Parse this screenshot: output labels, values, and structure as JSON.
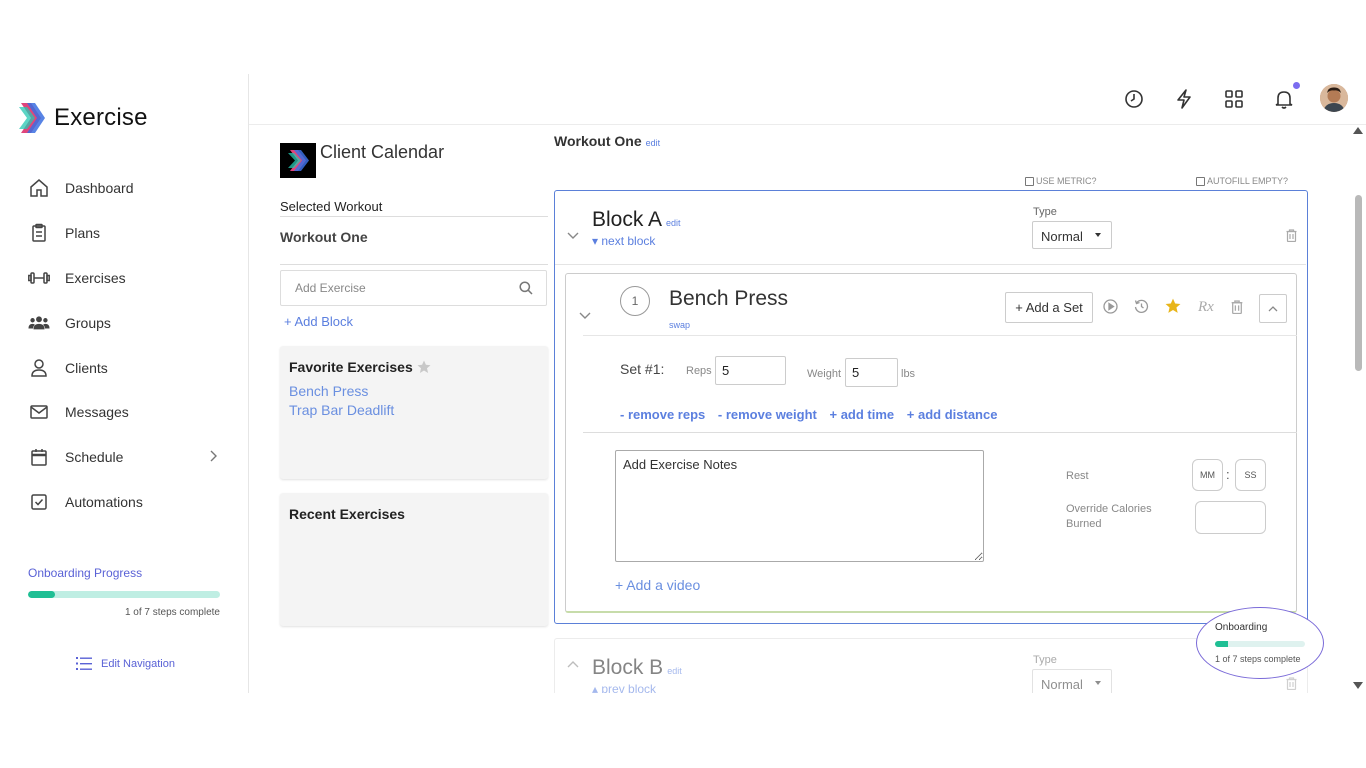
{
  "app": {
    "name": "Exercise"
  },
  "sidebar": {
    "items": [
      {
        "label": "Dashboard",
        "icon": "home-icon"
      },
      {
        "label": "Plans",
        "icon": "clipboard-icon"
      },
      {
        "label": "Exercises",
        "icon": "dumbbell-icon"
      },
      {
        "label": "Groups",
        "icon": "group-icon"
      },
      {
        "label": "Clients",
        "icon": "user-icon"
      },
      {
        "label": "Messages",
        "icon": "mail-icon"
      },
      {
        "label": "Schedule",
        "icon": "calendar-icon"
      },
      {
        "label": "Automations",
        "icon": "checkbox-icon"
      }
    ],
    "onboarding": {
      "title": "Onboarding Progress",
      "steps_text": "1 of 7 steps complete",
      "progress": 0.14
    },
    "edit_navigation": "Edit Navigation"
  },
  "topbar": {
    "icons": [
      "clock-icon",
      "lightning-icon",
      "grid-icon",
      "bell-icon",
      "avatar"
    ]
  },
  "colors": {
    "accent": "#5b80d8",
    "brand_purple": "#5a62d6",
    "progress_green": "#1fbf94",
    "star_gold": "#e8b51a"
  },
  "left_panel": {
    "title": "Client Calendar",
    "selected_label": "Selected Workout",
    "selected_workout": "Workout One",
    "search_placeholder": "Add Exercise",
    "add_block": "+ Add Block",
    "favorites": {
      "title": "Favorite Exercises",
      "items": [
        "Bench Press",
        "Trap Bar Deadlift"
      ]
    },
    "recent": {
      "title": "Recent Exercises"
    }
  },
  "workout": {
    "title": "Workout One",
    "edit": "edit",
    "use_metric": "USE METRIC?",
    "autofill_empty": "AUTOFILL EMPTY?",
    "blocks": [
      {
        "title": "Block A",
        "edit": "edit",
        "link": "▾ next block",
        "type_label": "Type",
        "type_value": "Normal",
        "exercise": {
          "number": "1",
          "name": "Bench Press",
          "swap": "swap",
          "add_set": "+ Add a Set",
          "rx": "Rx",
          "set_label": "Set #1:",
          "reps_label": "Reps",
          "reps_value": "5",
          "weight_label": "Weight",
          "weight_value": "5",
          "unit": "lbs",
          "remove_reps": "- remove reps",
          "remove_weight": "- remove weight",
          "add_time": "+ add time",
          "add_distance": "+ add distance",
          "notes_placeholder": "Add Exercise Notes",
          "rest_label": "Rest",
          "mm": "MM",
          "ss": "SS",
          "calories_label": "Override Calories Burned",
          "add_video": "+ Add a video"
        }
      },
      {
        "title": "Block B",
        "edit": "edit",
        "link": "▴ prev block",
        "type_label": "Type",
        "type_value": "Normal"
      }
    ]
  },
  "onboarding_bubble": {
    "title": "Onboarding",
    "steps_text": "1 of 7 steps complete",
    "progress": 0.14
  }
}
